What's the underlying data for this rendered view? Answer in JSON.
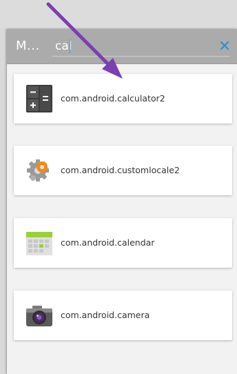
{
  "header": {
    "app_title": "M...",
    "search_value": "cal"
  },
  "colors": {
    "action_bar": "#ababab",
    "arrow": "#7b3fb0",
    "clear_icon": "#2b8fd6"
  },
  "apps": [
    {
      "label": "com.android.calculator2",
      "icon": "calculator-icon"
    },
    {
      "label": "com.android.customlocale2",
      "icon": "gear-settings-icon"
    },
    {
      "label": "com.android.calendar",
      "icon": "calendar-icon"
    },
    {
      "label": "com.android.camera",
      "icon": "camera-icon"
    }
  ]
}
